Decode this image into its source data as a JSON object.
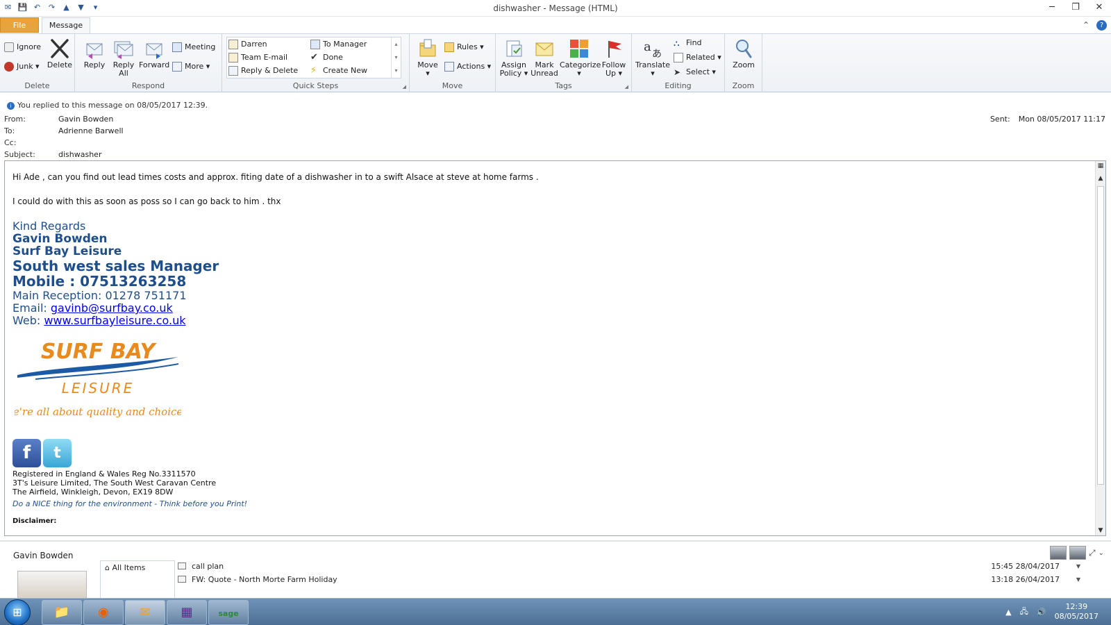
{
  "window": {
    "title": "dishwasher  - Message (HTML)",
    "controls": [
      "minimize",
      "restore",
      "close"
    ]
  },
  "tabs": {
    "file": "File",
    "message": "Message"
  },
  "ribbon": {
    "delete": {
      "label": "Delete",
      "ignore": "Ignore",
      "junk": "Junk",
      "delete": "Delete"
    },
    "respond": {
      "label": "Respond",
      "reply": "Reply",
      "reply_all_line1": "Reply",
      "reply_all_line2": "All",
      "forward": "Forward",
      "meeting": "Meeting",
      "more": "More"
    },
    "quick_steps": {
      "label": "Quick Steps",
      "items": [
        "Darren",
        "Team E-mail",
        "Reply & Delete",
        "To Manager",
        "Done",
        "Create New"
      ]
    },
    "move": {
      "label": "Move",
      "move": "Move",
      "rules": "Rules",
      "actions": "Actions"
    },
    "tags": {
      "label": "Tags",
      "assign_line1": "Assign",
      "assign_line2": "Policy",
      "mark_line1": "Mark",
      "mark_line2": "Unread",
      "categorize": "Categorize",
      "follow_line1": "Follow",
      "follow_line2": "Up"
    },
    "editing": {
      "label": "Editing",
      "translate": "Translate",
      "find": "Find",
      "related": "Related",
      "select": "Select"
    },
    "zoom": {
      "label": "Zoom",
      "zoom": "Zoom"
    }
  },
  "header": {
    "info": "You replied to this message on 08/05/2017 12:39.",
    "from_label": "From:",
    "from": "Gavin Bowden",
    "to_label": "To:",
    "to": "Adrienne Barwell",
    "cc_label": "Cc:",
    "cc": "",
    "subject_label": "Subject:",
    "subject": "dishwasher",
    "sent_label": "Sent:",
    "sent": "Mon 08/05/2017 11:17"
  },
  "body": {
    "line1": "Hi Ade , can you find out lead times costs and approx. fiting date of  a dishwasher in to a swift Alsace at steve at home farms .",
    "line2": "I could do with this as soon as poss so I can go back to him . thx"
  },
  "signature": {
    "regards": "Kind Regards",
    "name": "Gavin Bowden",
    "company": "Surf Bay Leisure",
    "role": "South west sales Manager",
    "mobile": "Mobile : 07513263258",
    "reception": "Main Reception:  01278 751171",
    "email_label": "Email: ",
    "email": "gavinb@surfbay.co.uk",
    "web_label": "Web: ",
    "web": "www.surfbayleisure.co.uk",
    "logo_top": "SURF BAY",
    "logo_bottom": "LEISURE",
    "tagline": "We're all about quality and choice!",
    "facebook": "f",
    "twitter": "t",
    "reg1": "Registered in England & Wales Reg No.3311570",
    "reg2": "3T's Leisure Limited, The South West Caravan Centre",
    "reg3": "The Airfield, Winkleigh, Devon, EX19 8DW",
    "environment": "Do a NICE thing for the environment - Think before you Print!",
    "disclaimer": "Disclaimer:"
  },
  "people": {
    "name": "Gavin Bowden",
    "all_items": "All Items",
    "mails": [
      {
        "subject": "call plan",
        "date": "15:45  28/04/2017"
      },
      {
        "subject": "FW: Quote - North Morte Farm Holiday",
        "date": "13:18  26/04/2017"
      }
    ]
  },
  "taskbar": {
    "time": "12:39",
    "date": "08/05/2017",
    "apps": [
      "explorer",
      "firefox",
      "outlook",
      "calculator",
      "sage"
    ]
  },
  "colors": {
    "file_tab": "#e8a33c",
    "signature_blue": "#1f4e8c",
    "logo_orange": "#e98a1e",
    "logo_blue": "#1c5aa6"
  }
}
